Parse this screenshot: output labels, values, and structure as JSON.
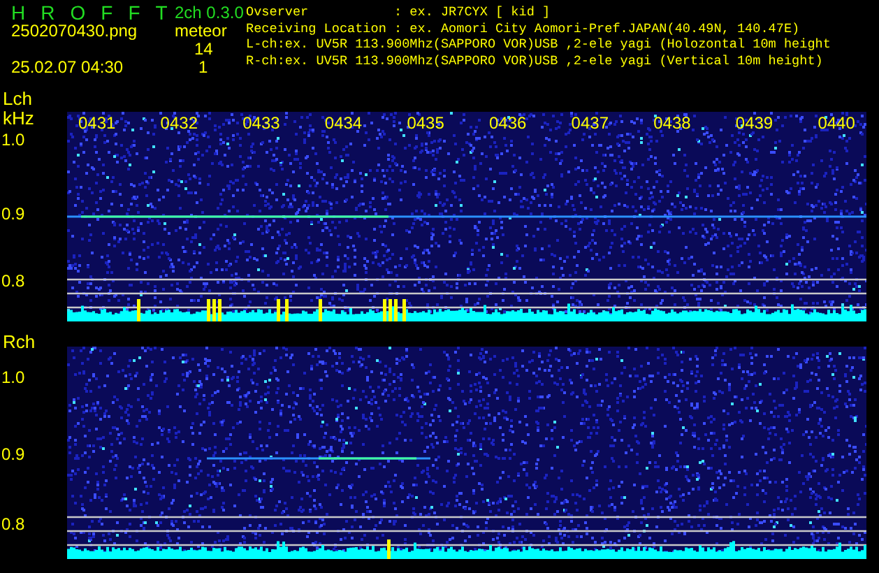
{
  "header": {
    "title_letters": [
      "H",
      "R",
      "O",
      "F",
      "F",
      "T"
    ],
    "version": "2ch 0.3.0",
    "filename": "2502070430.png",
    "datetime": "25.02.07 04:30",
    "meteor_label": "meteor",
    "counts": [
      "14",
      "1"
    ]
  },
  "info": [
    {
      "label": "Ovserver",
      "value": ": ex. JR7CYX [ kid ]"
    },
    {
      "label": "Receiving Location",
      "value": ": ex. Aomori City Aomori-Pref.JAPAN(40.49N, 140.47E)"
    }
  ],
  "channels_info": [
    "L-ch:ex. UV5R 113.900Mhz(SAPPORO VOR)USB ,2-ele yagi (Holozontal 10m height",
    "R-ch:ex. UV5R 113.900Mhz(SAPPORO VOR)USB ,2-ele yagi (Vertical 10m height)"
  ],
  "panels": [
    {
      "channel": "Lch",
      "unit": "kHz",
      "times": [
        "0431",
        "0432",
        "0433",
        "0434",
        "0435",
        "0436",
        "0437",
        "0438",
        "0439",
        "0440"
      ],
      "freqs": [
        "1.0",
        "0.9",
        "0.8"
      ]
    },
    {
      "channel": "Rch",
      "freqs": [
        "1.0",
        "0.9",
        "0.8"
      ]
    }
  ]
}
